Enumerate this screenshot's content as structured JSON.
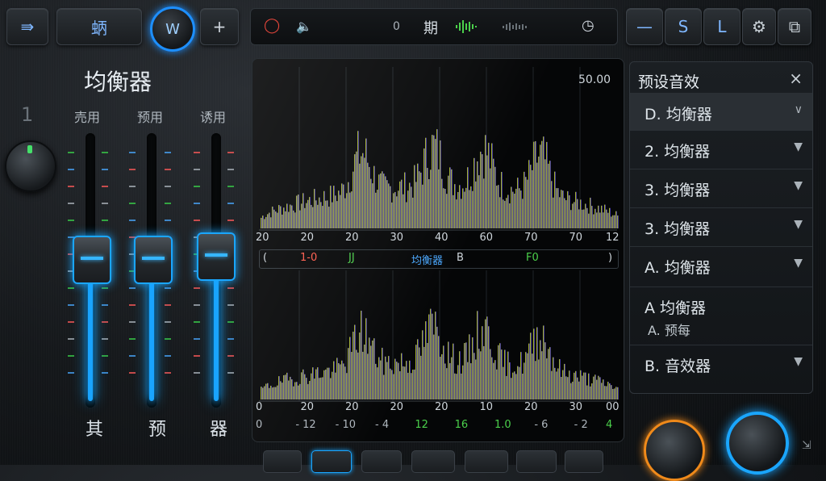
{
  "toolbar": {
    "btn1_icon": "⇛",
    "btn2_label": "蛃",
    "knob_label": "W",
    "add_label": "+",
    "right_btns": [
      "—",
      "S",
      "L"
    ],
    "gear_icon": "⚙",
    "copy_icon": "⧉"
  },
  "transport": {
    "record_icon": "◯",
    "volume_icon": "🔈",
    "marker": "0",
    "title": "期",
    "clock_icon": "◷"
  },
  "equalizer": {
    "title": "均衡器",
    "index": "1",
    "columns": [
      "売用",
      "预用",
      "诱用"
    ],
    "bottom_labels": [
      "其",
      "预",
      "器"
    ]
  },
  "spectrum": {
    "top_value": "50.00",
    "top_axis": [
      "20",
      "20",
      "20",
      "30",
      "40",
      "60",
      "70",
      "70",
      "12"
    ],
    "mid_left": "(",
    "mid_red": "1-0",
    "mid_green1": "JJ",
    "mid_title": "均衡器",
    "mid_b": "B",
    "mid_green2": "F0",
    "mid_right": ")",
    "bottom_axis": [
      "0",
      "20",
      "20",
      "20",
      "20",
      "10",
      "20",
      "30",
      "00"
    ],
    "bottom_values": [
      "0",
      "- 12",
      "- 10",
      "- 4",
      "12",
      "16",
      "1.0",
      "- 6",
      "- 2",
      "4"
    ]
  },
  "presets": {
    "title": "预设音效",
    "close": "×",
    "items": [
      {
        "label": "D. 均衡器",
        "arrow": "∨"
      },
      {
        "label": "2. 均衡器",
        "arrow": "▼"
      },
      {
        "label": "3. 均衡器",
        "arrow": "▼"
      },
      {
        "label": "3. 均衡器",
        "arrow": "▼"
      },
      {
        "label": "A. 均衡器",
        "arrow": "▼"
      },
      {
        "label": "A  均衡器",
        "sub": "A. 预每",
        "arrow": ""
      },
      {
        "label": "B. 音效器",
        "arrow": "▼"
      }
    ]
  },
  "colors": {
    "accent": "#1aa6ff",
    "panel": "#121518"
  }
}
